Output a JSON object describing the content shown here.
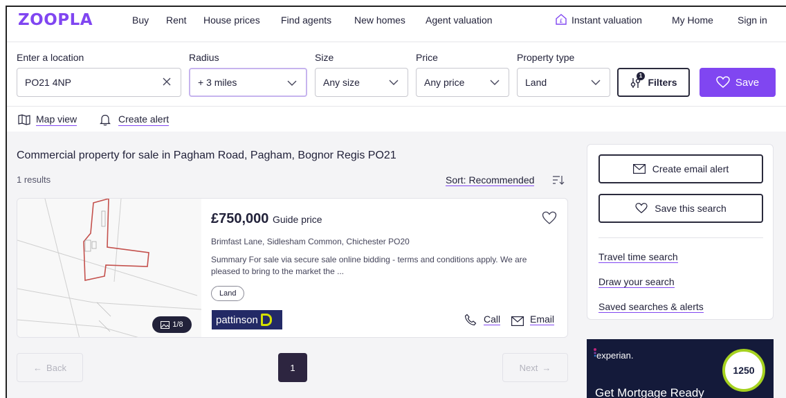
{
  "brand": {
    "logo": "ZOOPLA",
    "accent": "#8046f1"
  },
  "nav": {
    "items": [
      "Buy",
      "Rent",
      "House prices",
      "Find agents",
      "New homes",
      "Agent valuation"
    ],
    "instant_valuation": "Instant valuation",
    "my_home": "My Home",
    "sign_in": "Sign in"
  },
  "search": {
    "location": {
      "label": "Enter a location",
      "value": "PO21 4NP"
    },
    "radius": {
      "label": "Radius",
      "value": "+ 3 miles"
    },
    "size": {
      "label": "Size",
      "value": "Any size"
    },
    "price": {
      "label": "Price",
      "value": "Any price"
    },
    "property_type": {
      "label": "Property type",
      "value": "Land"
    },
    "filters_label": "Filters",
    "filters_count": "1",
    "save_label": "Save"
  },
  "toolbar": {
    "map_view": "Map view",
    "create_alert": "Create alert"
  },
  "results": {
    "title": "Commercial property for sale in Pagham Road, Pagham, Bognor Regis PO21",
    "count": "1 results",
    "sort": "Sort: Recommended"
  },
  "listing": {
    "price": "£750,000",
    "price_qualifier": "Guide price",
    "address": "Brimfast Lane, Sidlesham Common, Chichester PO20",
    "summary": "Summary For sale via secure sale online bidding - terms and conditions apply. We are pleased to bring to the market the ...",
    "tag": "Land",
    "image_count": "1/8",
    "agent": "pattinson",
    "call": "Call",
    "email": "Email"
  },
  "pagination": {
    "back": "Back",
    "next": "Next",
    "current": "1"
  },
  "sidebar": {
    "create_email_alert": "Create email alert",
    "save_search": "Save this search",
    "links": [
      "Travel time search",
      "Draw your search",
      "Saved searches & alerts"
    ]
  },
  "ad": {
    "brand": "experian.",
    "title": "Get Mortgage Ready",
    "score": "1250"
  }
}
